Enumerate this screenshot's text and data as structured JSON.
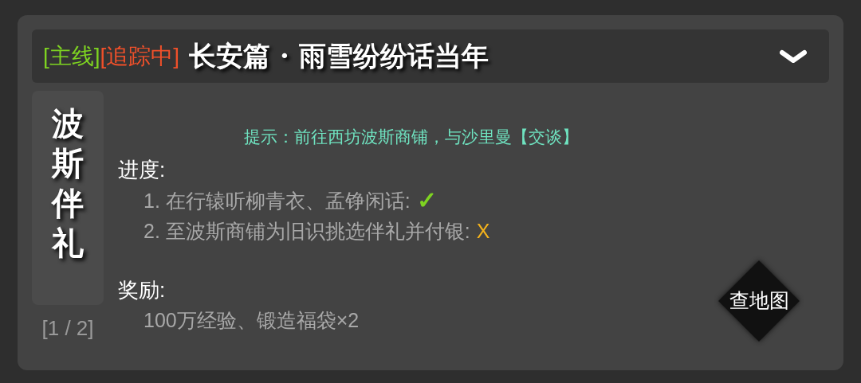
{
  "header": {
    "tags": [
      {
        "text": "[主线]",
        "color": "#7ed321"
      },
      {
        "text": "[追踪中]",
        "color": "#f0502a"
      }
    ],
    "title": "长安篇 · 雨雪纷纷话当年",
    "expanded": true
  },
  "quest": {
    "name": "波斯伴礼",
    "page": "[1 / 2]",
    "hint": "提示：前往西坊波斯商铺，与沙里曼【交谈】",
    "progress_label": "进度:",
    "steps": [
      {
        "text": "1. 在行辕听柳青衣、孟铮闲话:",
        "mark": "✓",
        "done": true
      },
      {
        "text": "2. 至波斯商铺为旧识挑选伴礼并付银:",
        "mark": "X",
        "done": false
      }
    ],
    "reward_label": "奖励:",
    "reward": "100万经验、锻造福袋×2",
    "map_button": "查地图"
  }
}
